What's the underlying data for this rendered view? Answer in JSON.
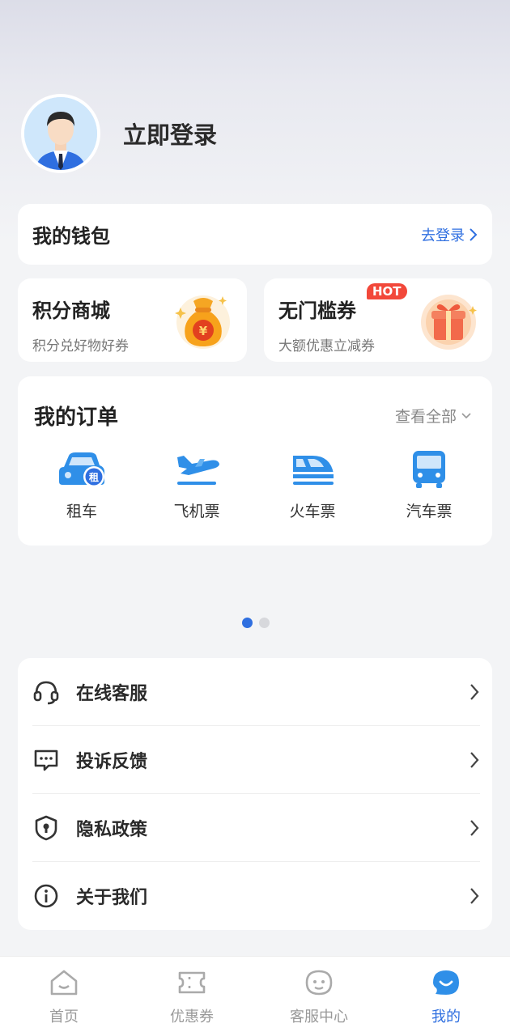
{
  "profile": {
    "login_label": "立即登录",
    "avatar": "user-avatar"
  },
  "wallet": {
    "title": "我的钱包",
    "action": "去登录"
  },
  "promos": [
    {
      "title": "积分商城",
      "subtitle": "积分兑好物好券",
      "icon": "money-bag-icon"
    },
    {
      "title": "无门槛券",
      "subtitle": "大额优惠立减券",
      "badge": "HOT",
      "icon": "gift-box-icon"
    }
  ],
  "orders": {
    "title": "我的订单",
    "view_all": "查看全部",
    "items": [
      {
        "label": "租车",
        "icon": "car-rental-icon"
      },
      {
        "label": "飞机票",
        "icon": "airplane-icon"
      },
      {
        "label": "火车票",
        "icon": "train-icon"
      },
      {
        "label": "汽车票",
        "icon": "bus-icon"
      }
    ]
  },
  "carousel": {
    "pages": 2,
    "active": 1
  },
  "menu": [
    {
      "label": "在线客服",
      "icon": "headset-icon"
    },
    {
      "label": "投诉反馈",
      "icon": "chat-bubble-icon"
    },
    {
      "label": "隐私政策",
      "icon": "shield-lock-icon"
    },
    {
      "label": "关于我们",
      "icon": "info-icon"
    }
  ],
  "tabbar": [
    {
      "label": "首页",
      "icon": "home-icon"
    },
    {
      "label": "优惠券",
      "icon": "ticket-icon"
    },
    {
      "label": "客服中心",
      "icon": "service-face-icon"
    },
    {
      "label": "我的",
      "icon": "profile-bubble-icon",
      "active": true
    }
  ],
  "colors": {
    "accent": "#2f6fe0",
    "hot": "#f2483a",
    "background": "#f3f4f6"
  }
}
